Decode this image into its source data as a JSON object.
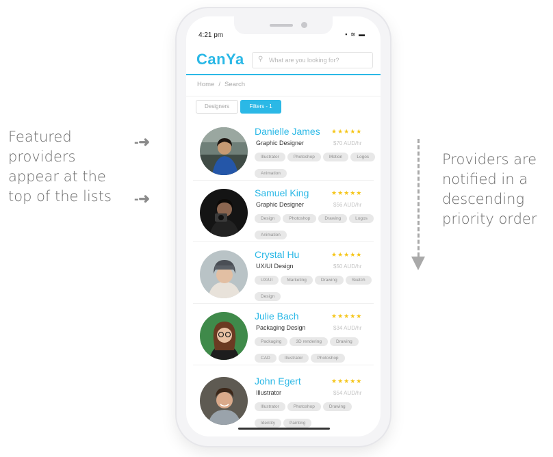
{
  "annotations": {
    "left_text": [
      "Featured",
      "providers",
      "appear at the",
      "top of the lists"
    ],
    "right_text": [
      "Providers are",
      "notified in a",
      "descending",
      "priority order"
    ]
  },
  "status_bar": {
    "time": "4:21 pm",
    "icons": "▪ ≋ ▬"
  },
  "app": {
    "logo": "CanYa",
    "search": {
      "placeholder": "What are you looking for?"
    },
    "breadcrumb": {
      "home": "Home",
      "separator": "/",
      "current": "Search"
    },
    "tabs": {
      "designers": "Designers",
      "filters": "Filters - 1"
    },
    "accent": "#2bb8e6",
    "star_color": "#f5c518"
  },
  "providers": [
    {
      "name": "Danielle James",
      "stars": "★★★★★",
      "role": "Graphic Designer",
      "rate": "$70 AUD/hr",
      "tags": [
        "Illustrator",
        "Photoshop",
        "Motion",
        "Logos",
        "Animation"
      ]
    },
    {
      "name": "Samuel King",
      "stars": "★★★★★",
      "role": "Graphic Designer",
      "rate": "$56 AUD/hr",
      "tags": [
        "Design",
        "Photoshop",
        "Drawing",
        "Logos",
        "Animation"
      ]
    },
    {
      "name": "Crystal Hu",
      "stars": "★★★★★",
      "role": "UX/UI Design",
      "rate": "$50 AUD/hr",
      "tags": [
        "UX/UI",
        "Marketing",
        "Drawing",
        "Sketch",
        "Design"
      ]
    },
    {
      "name": "Julie Bach",
      "stars": "★★★★★",
      "role": "Packaging Design",
      "rate": "$34 AUD/hr",
      "tags": [
        "Packaging",
        "3D rendering",
        "Drawing",
        "CAD",
        "Illustrator",
        "Photoshop"
      ]
    },
    {
      "name": "John Egert",
      "stars": "★★★★★",
      "role": "Illustrator",
      "rate": "$54 AUD/hr",
      "tags": [
        "Illustrator",
        "Photoshop",
        "Drawing",
        "Identity",
        "Painting"
      ]
    }
  ]
}
